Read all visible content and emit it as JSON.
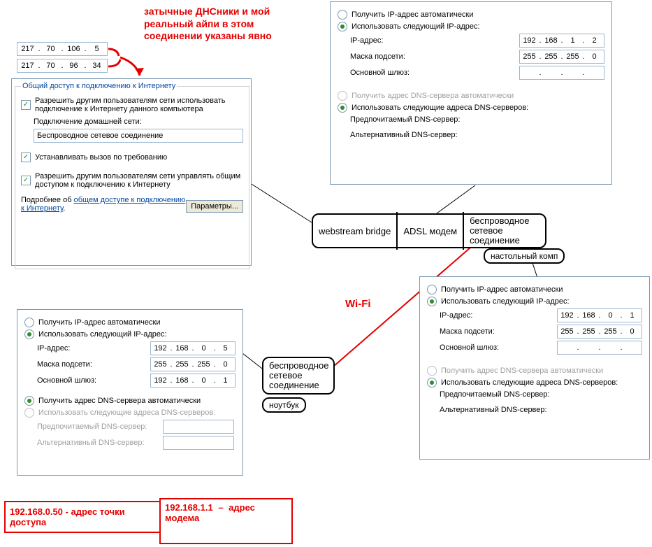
{
  "annotations": {
    "red_note": "затычные ДНСники и мой реальный айпи в этом соединении указаны явно",
    "wifi": "Wi-Fi",
    "desktop_label": "настольный комп",
    "laptop_label": "ноутбук",
    "ap_box": "192.168.0.50 - адрес точки доступа",
    "modem_box_ip": "192.168.1.1",
    "modem_box_dash": "–",
    "modem_box_text": "адрес модема"
  },
  "dns_plugs": {
    "a": [
      "217",
      "70",
      "106",
      "5"
    ],
    "b": [
      "217",
      "70",
      "96",
      "34"
    ]
  },
  "ics": {
    "legend": "Общий доступ к подключению к Интернету",
    "allow_share": "Разрешить другим пользователям сети использовать подключение к Интернету данного компьютера",
    "home_conn_label": "Подключение домашней сети:",
    "home_conn_value": "Беспроводное сетевое соединение",
    "dial_on_demand": "Устанавливать вызов по требованию",
    "allow_control": "Разрешить другим пользователям сети управлять общим доступом к подключению к Интернету",
    "more_prefix": "Подробнее об ",
    "more_link": "общем доступе к подключению к Интернету",
    "params_btn": "Параметры..."
  },
  "ip_labels": {
    "obtain_auto": "Получить IP-адрес автоматически",
    "use_following": "Использовать следующий IP-адрес:",
    "ip": "IP-адрес:",
    "mask": "Маска подсети:",
    "gw": "Основной шлюз:",
    "dns_auto": "Получить адрес DNS-сервера автоматически",
    "dns_use": "Использовать следующие адреса DNS-серверов:",
    "dns_pref": "Предпочитаемый DNS-сервер:",
    "dns_alt": "Альтернативный DNS-сервер:"
  },
  "panel_top_right": {
    "ip": [
      "192",
      "168",
      "1",
      "2"
    ],
    "mask": [
      "255",
      "255",
      "255",
      "0"
    ],
    "gw": [
      "",
      "",
      "",
      ""
    ]
  },
  "panel_right_mid": {
    "ip": [
      "192",
      "168",
      "0",
      "1"
    ],
    "mask": [
      "255",
      "255",
      "255",
      "0"
    ],
    "gw": [
      "",
      "",
      "",
      ""
    ]
  },
  "panel_left_bottom": {
    "ip": [
      "192",
      "168",
      "0",
      "5"
    ],
    "mask": [
      "255",
      "255",
      "255",
      "0"
    ],
    "gw": [
      "192",
      "168",
      "0",
      "1"
    ]
  },
  "devices": {
    "bridge": "webstream bridge",
    "adsl": "ADSL модем",
    "wlan": "беспроводное сетевое соединение",
    "wlan2": "беспроводное сетевое соединение"
  }
}
